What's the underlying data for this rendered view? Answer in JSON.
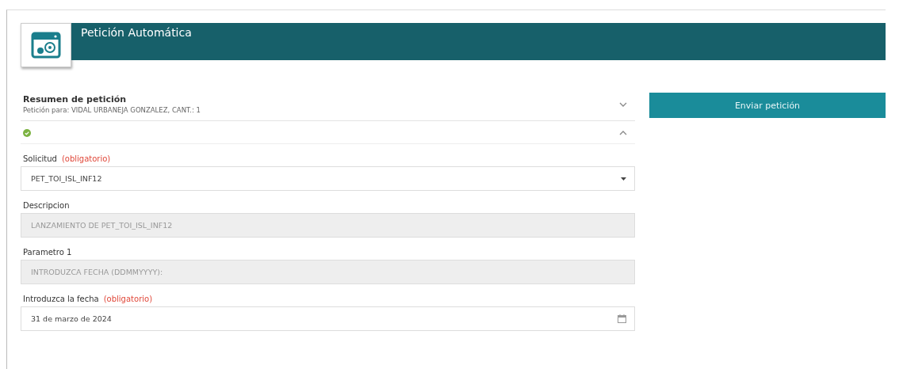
{
  "header": {
    "title": "Petición Automática"
  },
  "summary": {
    "title": "Resumen de petición",
    "subtitle": "Petición para: VIDAL URBANEJA GONZALEZ, CANT.: 1",
    "expanded": false
  },
  "section": {
    "valid": true,
    "expanded": true
  },
  "fields": [
    {
      "kind": "select",
      "label": "Solicitud",
      "note": "(obligatorio)",
      "value": "PET_TOI_ISL_INF12"
    },
    {
      "kind": "readonly",
      "label": "Descripcion",
      "value": "LANZAMIENTO DE PET_TOI_ISL_INF12"
    },
    {
      "kind": "readonly",
      "label": "Parametro 1",
      "value": "INTRODUZCA FECHA (DDMMYYYY):"
    },
    {
      "kind": "date",
      "label": "Introduzca la fecha",
      "note": "(obligatorio)",
      "value": "31 de marzo de 2024"
    }
  ],
  "submit_button": "Enviar petición"
}
